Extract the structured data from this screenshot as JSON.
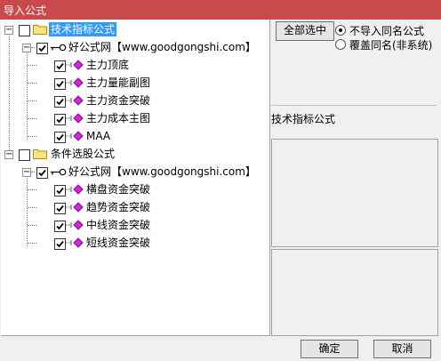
{
  "window": {
    "title": "导入公式"
  },
  "tree": {
    "root1": {
      "label": "技术指标公式"
    },
    "root1_child": {
      "label": "好公式网【www.goodgongshi.com】"
    },
    "root1_items": [
      "主力顶底",
      "主力量能副图",
      "主力资金突破",
      "主力成本主图",
      "MAA"
    ],
    "root2": {
      "label": "条件选股公式"
    },
    "root2_child": {
      "label": "好公式网【www.goodgongshi.com】"
    },
    "root2_items": [
      "横盘资金突破",
      "趋势资金突破",
      "中线资金突破",
      "短线资金突破"
    ]
  },
  "options": {
    "select_all_label": "全部选中",
    "radio_no_import": "不导入同名公式",
    "radio_overwrite": "覆盖同名(非系统)"
  },
  "info": {
    "panel_title": "技术指标公式"
  },
  "footer": {
    "ok_label": "确定",
    "cancel_label": "取消"
  },
  "colors": {
    "titlebar": "#c84a4d",
    "selection": "#3399ff",
    "diamond": "#d02ad6",
    "folder": "#ffe27a"
  }
}
